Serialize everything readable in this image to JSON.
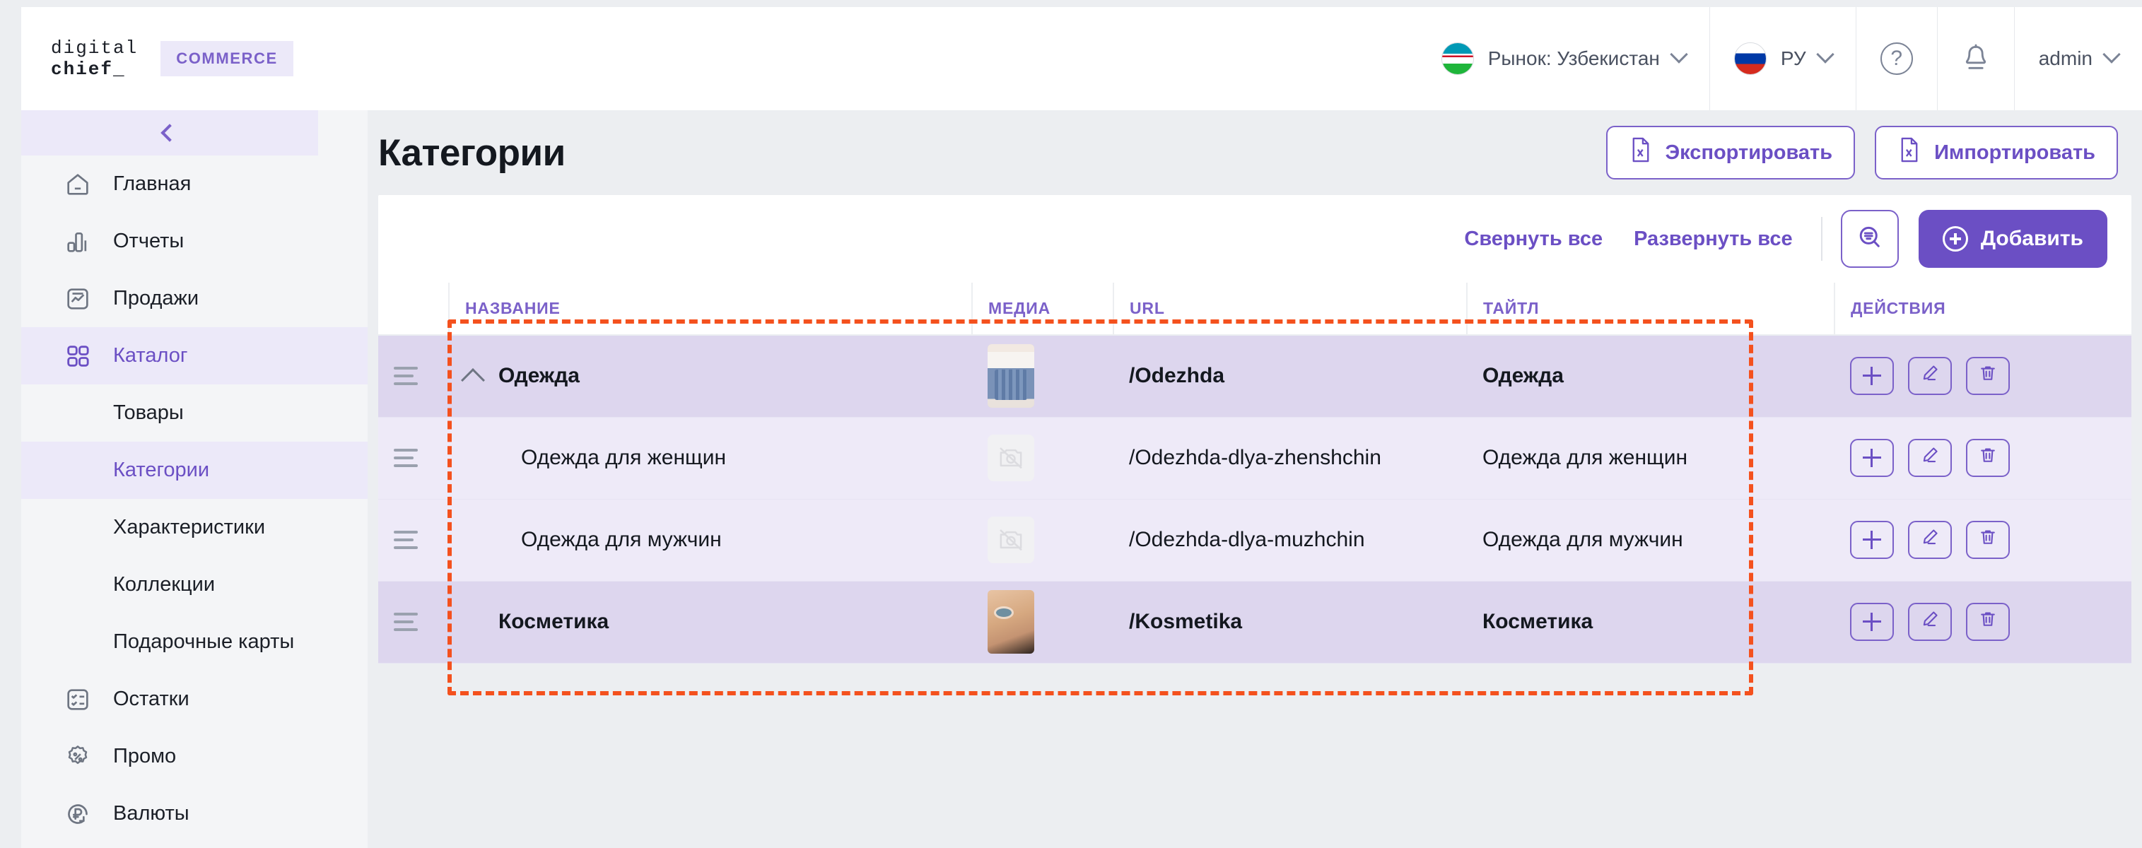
{
  "topbar": {
    "logo_line1": "digital",
    "logo_line2": "chief_",
    "badge": "COMMERCE",
    "market_label": "Рынок: Узбекистан",
    "language_label": "РУ",
    "help_icon": "question-mark",
    "notification_icon": "bell",
    "user_label": "admin"
  },
  "sidebar": {
    "collapse_icon": "chevron-left",
    "items": [
      {
        "label": "Главная",
        "icon": "home-icon",
        "active": false,
        "sub": false
      },
      {
        "label": "Отчеты",
        "icon": "chart-bars-icon",
        "active": false,
        "sub": false
      },
      {
        "label": "Продажи",
        "icon": "sales-chart-icon",
        "active": false,
        "sub": false
      },
      {
        "label": "Каталог",
        "icon": "grid-icon",
        "active": true,
        "sub": false
      },
      {
        "label": "Товары",
        "icon": "",
        "active": false,
        "sub": true
      },
      {
        "label": "Категории",
        "icon": "",
        "active": true,
        "sub": true
      },
      {
        "label": "Характеристики",
        "icon": "",
        "active": false,
        "sub": true
      },
      {
        "label": "Коллекции",
        "icon": "",
        "active": false,
        "sub": true
      },
      {
        "label": "Подарочные карты",
        "icon": "",
        "active": false,
        "sub": true
      },
      {
        "label": "Остатки",
        "icon": "checklist-icon",
        "active": false,
        "sub": false
      },
      {
        "label": "Промо",
        "icon": "percent-badge-icon",
        "active": false,
        "sub": false
      },
      {
        "label": "Валюты",
        "icon": "ruble-refresh-icon",
        "active": false,
        "sub": false
      }
    ]
  },
  "page": {
    "title": "Категории",
    "export_button": "Экспортировать",
    "import_button": "Импортировать",
    "export_icon": "excel-file-icon",
    "import_icon": "excel-file-icon"
  },
  "toolbar": {
    "collapse_all": "Свернуть все",
    "expand_all": "Развернуть все",
    "search_icon": "search-filter-icon",
    "add_button": "Добавить",
    "add_icon": "plus-circle-icon"
  },
  "table": {
    "columns": [
      "НАЗВАНИЕ",
      "МЕДИА",
      "URL",
      "ТАЙТЛ",
      "ДЕЙСТВИЯ"
    ],
    "rows": [
      {
        "name": "Одежда",
        "url": "/Odezhda",
        "title": "Одежда",
        "level": 0,
        "expanded": true,
        "media": "clothes-thumbnail",
        "actions": [
          "add-icon",
          "edit-icon",
          "delete-icon"
        ]
      },
      {
        "name": "Одежда для женщин",
        "url": "/Odezhda-dlya-zhenshchin",
        "title": "Одежда для женщин",
        "level": 1,
        "expanded": false,
        "media": "no-image-placeholder",
        "actions": [
          "add-icon",
          "edit-icon",
          "delete-icon"
        ]
      },
      {
        "name": "Одежда для мужчин",
        "url": "/Odezhda-dlya-muzhchin",
        "title": "Одежда для мужчин",
        "level": 1,
        "expanded": false,
        "media": "no-image-placeholder",
        "actions": [
          "add-icon",
          "edit-icon",
          "delete-icon"
        ]
      },
      {
        "name": "Косметика",
        "url": "/Kosmetika",
        "title": "Косметика",
        "level": 0,
        "expanded": false,
        "media": "face-thumbnail",
        "actions": [
          "add-icon",
          "edit-icon",
          "delete-icon"
        ]
      }
    ]
  },
  "annotation": {
    "type": "dashed-rectangle-highlight",
    "color": "#f4511e"
  },
  "colors": {
    "accent_purple": "#6b4fc4",
    "accent_purple_light": "#7b61c9",
    "row_level0_bg": "#ddd6ee",
    "row_level1_bg": "#eeeaf8",
    "annotation": "#f4511e"
  }
}
